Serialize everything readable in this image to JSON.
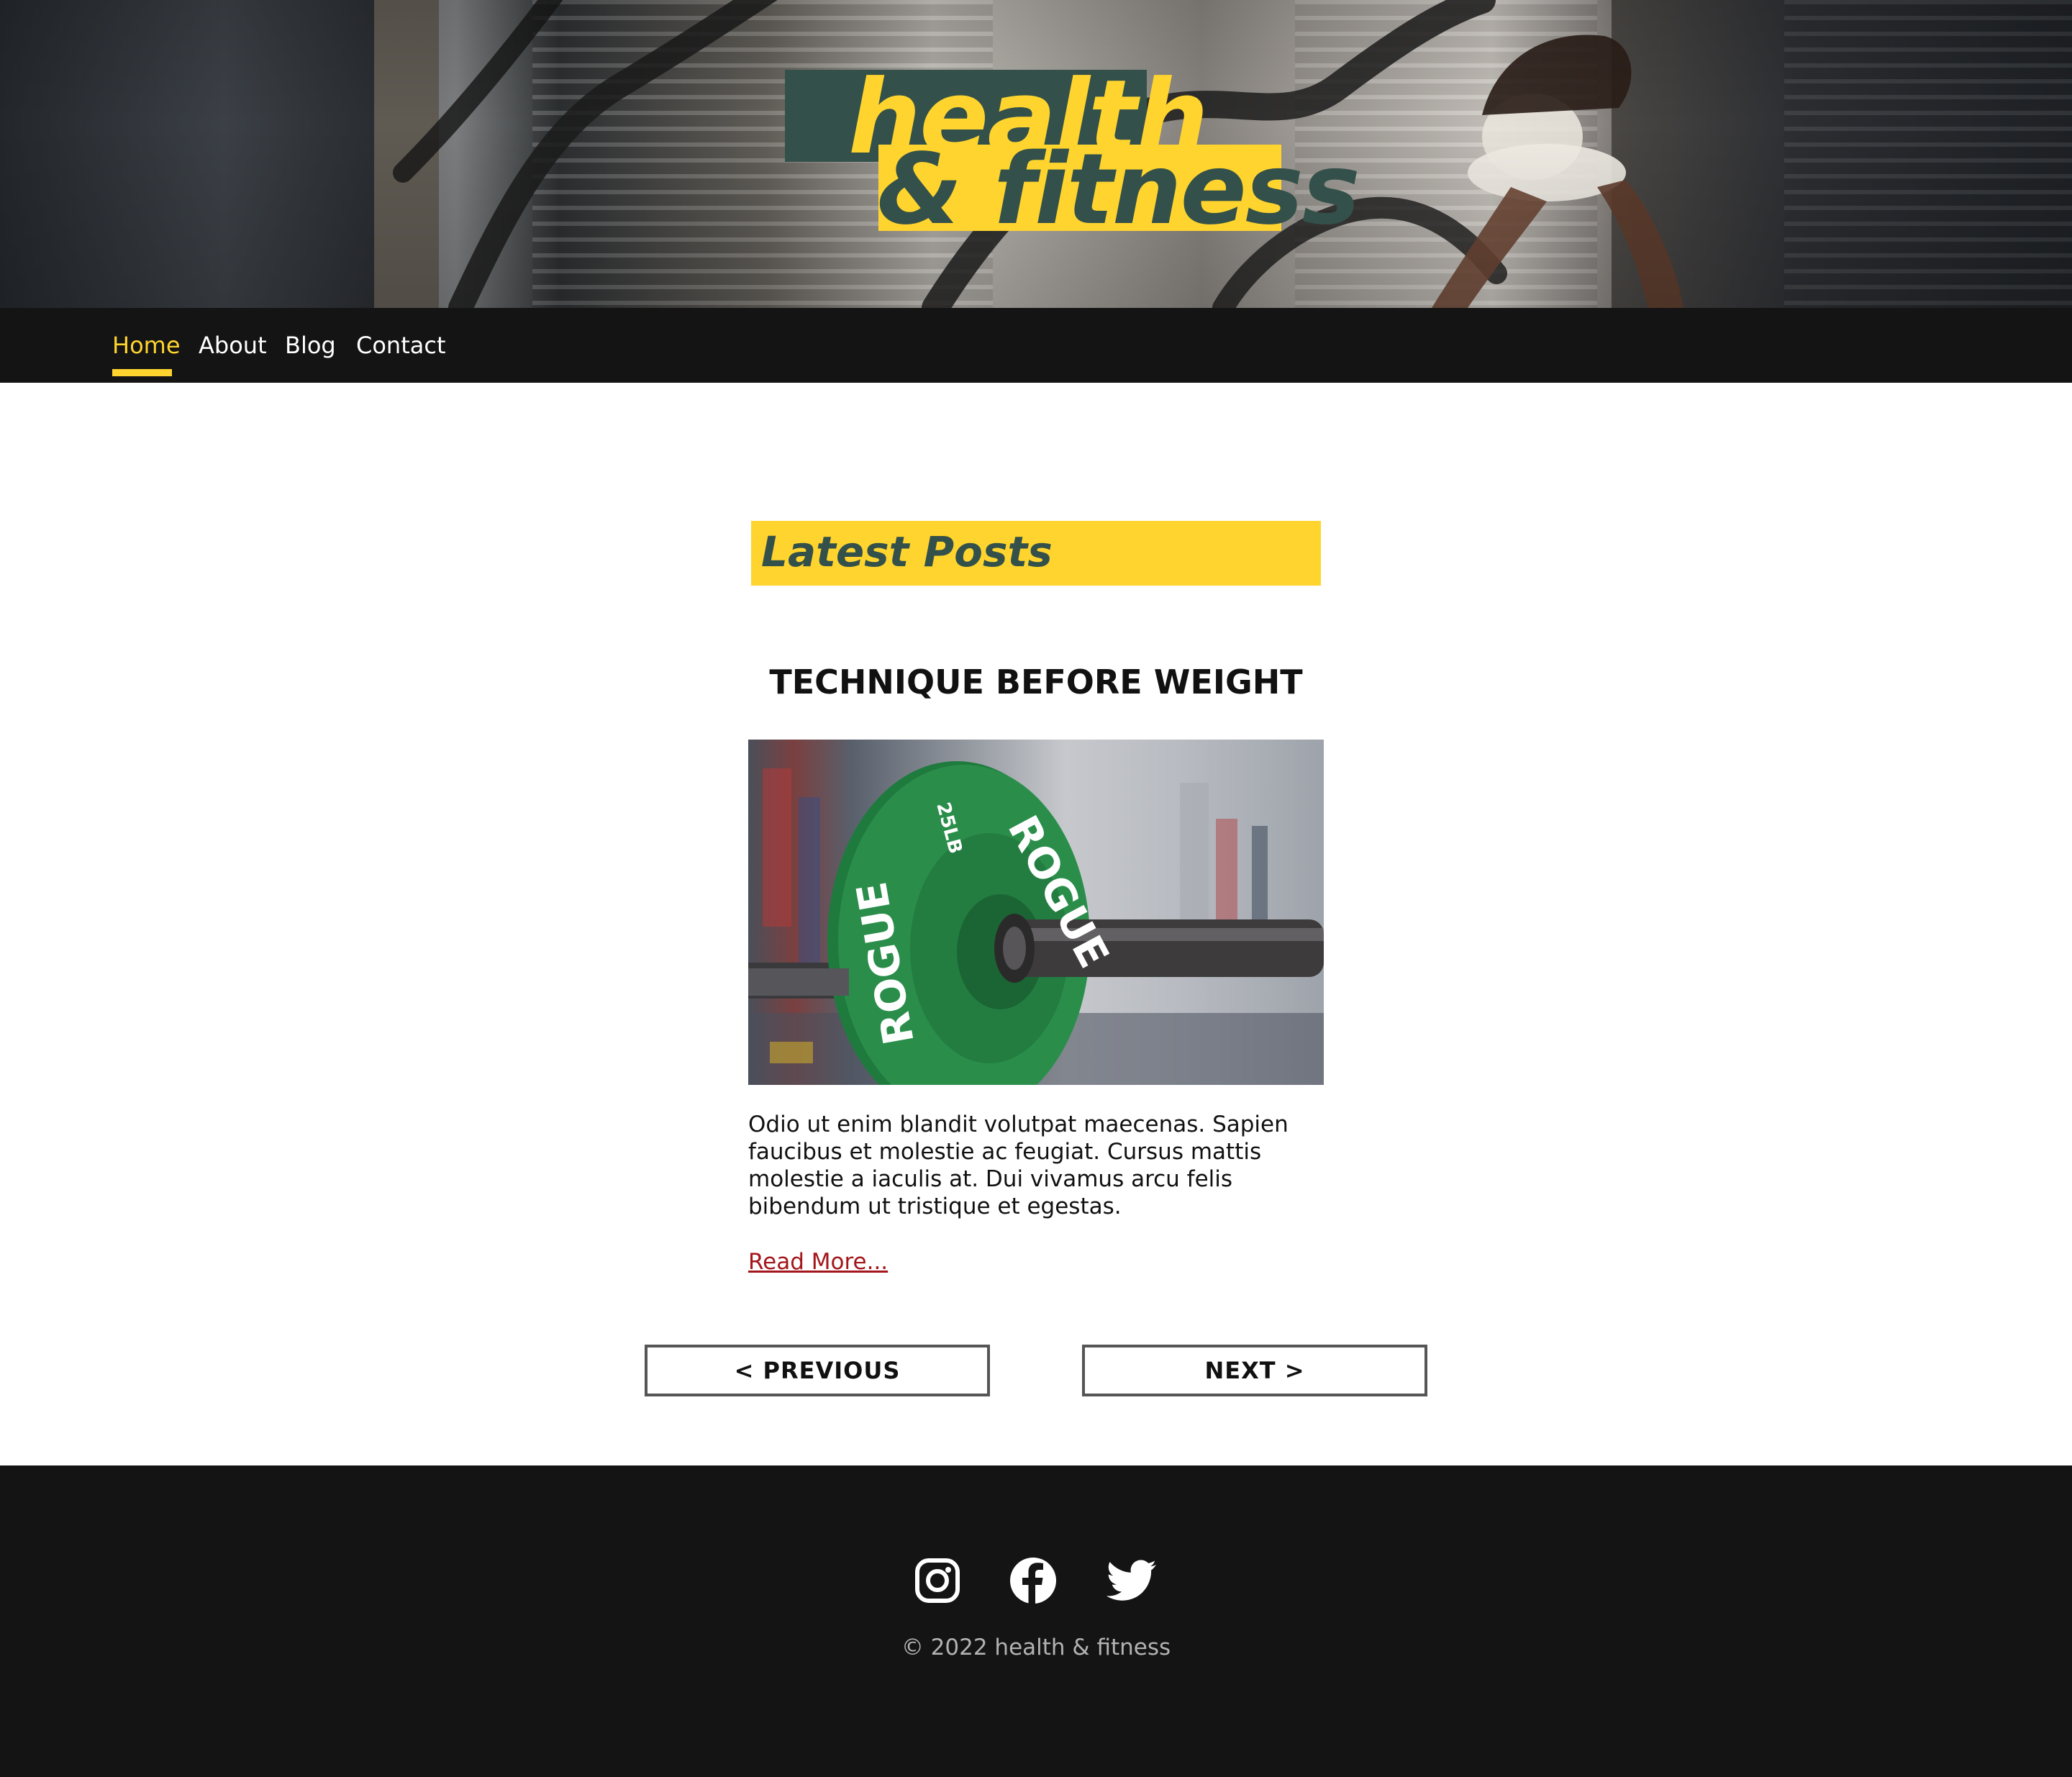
{
  "site": {
    "logo_line1": "health",
    "logo_line2": "& fitness",
    "brand_colors": {
      "yellow": "#ffd42e",
      "dark_green": "#33514a",
      "nav_background": "#141414",
      "link_red": "#a3161b"
    }
  },
  "nav": {
    "items": [
      {
        "label": "Home",
        "active": true
      },
      {
        "label": "About",
        "active": false
      },
      {
        "label": "Blog",
        "active": false
      },
      {
        "label": "Contact",
        "active": false
      }
    ]
  },
  "main": {
    "section_title": "Latest Posts",
    "post": {
      "title": "TECHNIQUE BEFORE WEIGHT",
      "image_alt": "Green Rogue 25LB weight plate on barbell",
      "image_text": [
        "ROGUE",
        "25LB"
      ],
      "excerpt": "Odio ut enim blandit volutpat maecenas. Sapien faucibus et molestie ac feugiat. Cursus mattis molestie a iaculis at. Dui vivamus arcu felis bibendum ut tristique et egestas.",
      "read_more": "Read More..."
    },
    "pagination": {
      "previous": "< PREVIOUS",
      "next": "NEXT >"
    }
  },
  "footer": {
    "social_icons": [
      "instagram-icon",
      "facebook-icon",
      "twitter-icon"
    ],
    "copyright": "© 2022 health & fitness"
  }
}
